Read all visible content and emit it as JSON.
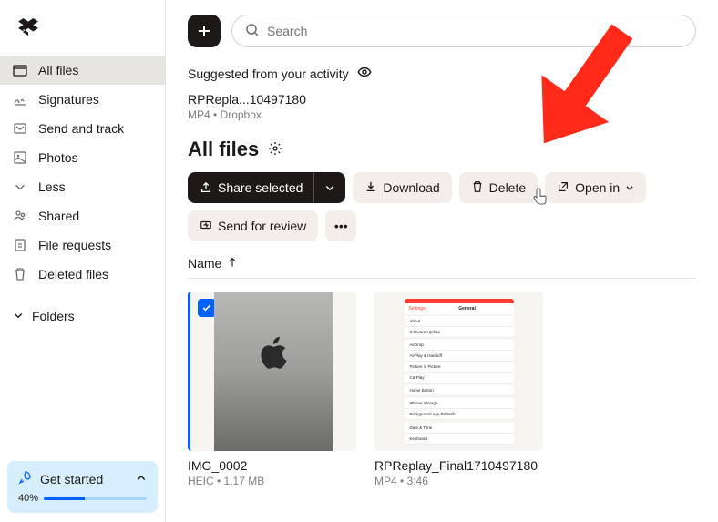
{
  "sidebar": {
    "items": [
      {
        "label": "All files"
      },
      {
        "label": "Signatures"
      },
      {
        "label": "Send and track"
      },
      {
        "label": "Photos"
      },
      {
        "label": "Less"
      },
      {
        "label": "Shared"
      },
      {
        "label": "File requests"
      },
      {
        "label": "Deleted files"
      }
    ],
    "folders_label": "Folders"
  },
  "get_started": {
    "title": "Get started",
    "percent": "40%",
    "progress": 40
  },
  "search": {
    "placeholder": "Search"
  },
  "suggested": {
    "label": "Suggested from your activity",
    "card_title": "RPRepla...10497180",
    "card_sub": "MP4 • Dropbox"
  },
  "files": {
    "title": "All files",
    "col_name": "Name",
    "items": [
      {
        "name": "IMG_0002",
        "meta": "HEIC • 1.17 MB",
        "selected": true
      },
      {
        "name": "RPReplay_Final1710497180",
        "meta": "MP4 • 3:46",
        "selected": false
      }
    ]
  },
  "actions": {
    "share": "Share selected",
    "download": "Download",
    "delete": "Delete",
    "open_in": "Open in",
    "send_review": "Send for review"
  },
  "settings_thumb": {
    "back": "Settings",
    "title": "General",
    "rows": [
      "About",
      "Software Update",
      "AirDrop",
      "AirPlay & Handoff",
      "Picture in Picture",
      "CarPlay",
      "Home Button",
      "iPhone Storage",
      "Background App Refresh",
      "Date & Time",
      "Keyboard"
    ]
  }
}
